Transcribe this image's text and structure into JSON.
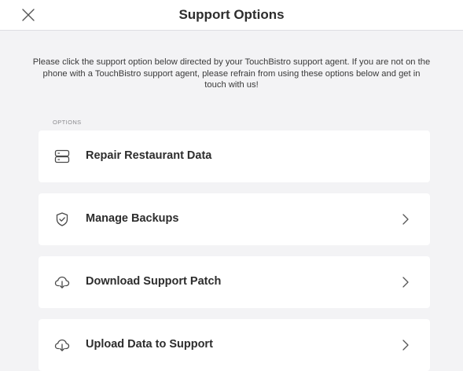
{
  "header": {
    "title": "Support Options",
    "close_icon": "close-icon"
  },
  "intro": {
    "text": "Please click the support option below directed by your TouchBistro support agent. If you are not on the phone with a TouchBistro support agent, please refrain from using these options below and get in touch with us!"
  },
  "options_section": {
    "label": "OPTIONS",
    "items": [
      {
        "label": "Repair Restaurant Data",
        "icon": "server-icon",
        "has_chevron": false
      },
      {
        "label": "Manage Backups",
        "icon": "shield-check-icon",
        "has_chevron": true
      },
      {
        "label": "Download Support Patch",
        "icon": "cloud-download-icon",
        "has_chevron": true
      },
      {
        "label": "Upload Data to Support",
        "icon": "cloud-upload-icon",
        "has_chevron": true
      }
    ]
  },
  "colors": {
    "background": "#f3f3f5",
    "card": "#ffffff",
    "text": "#2d2d2d",
    "icon": "#4a4a4a",
    "muted": "#8a8a8e"
  }
}
